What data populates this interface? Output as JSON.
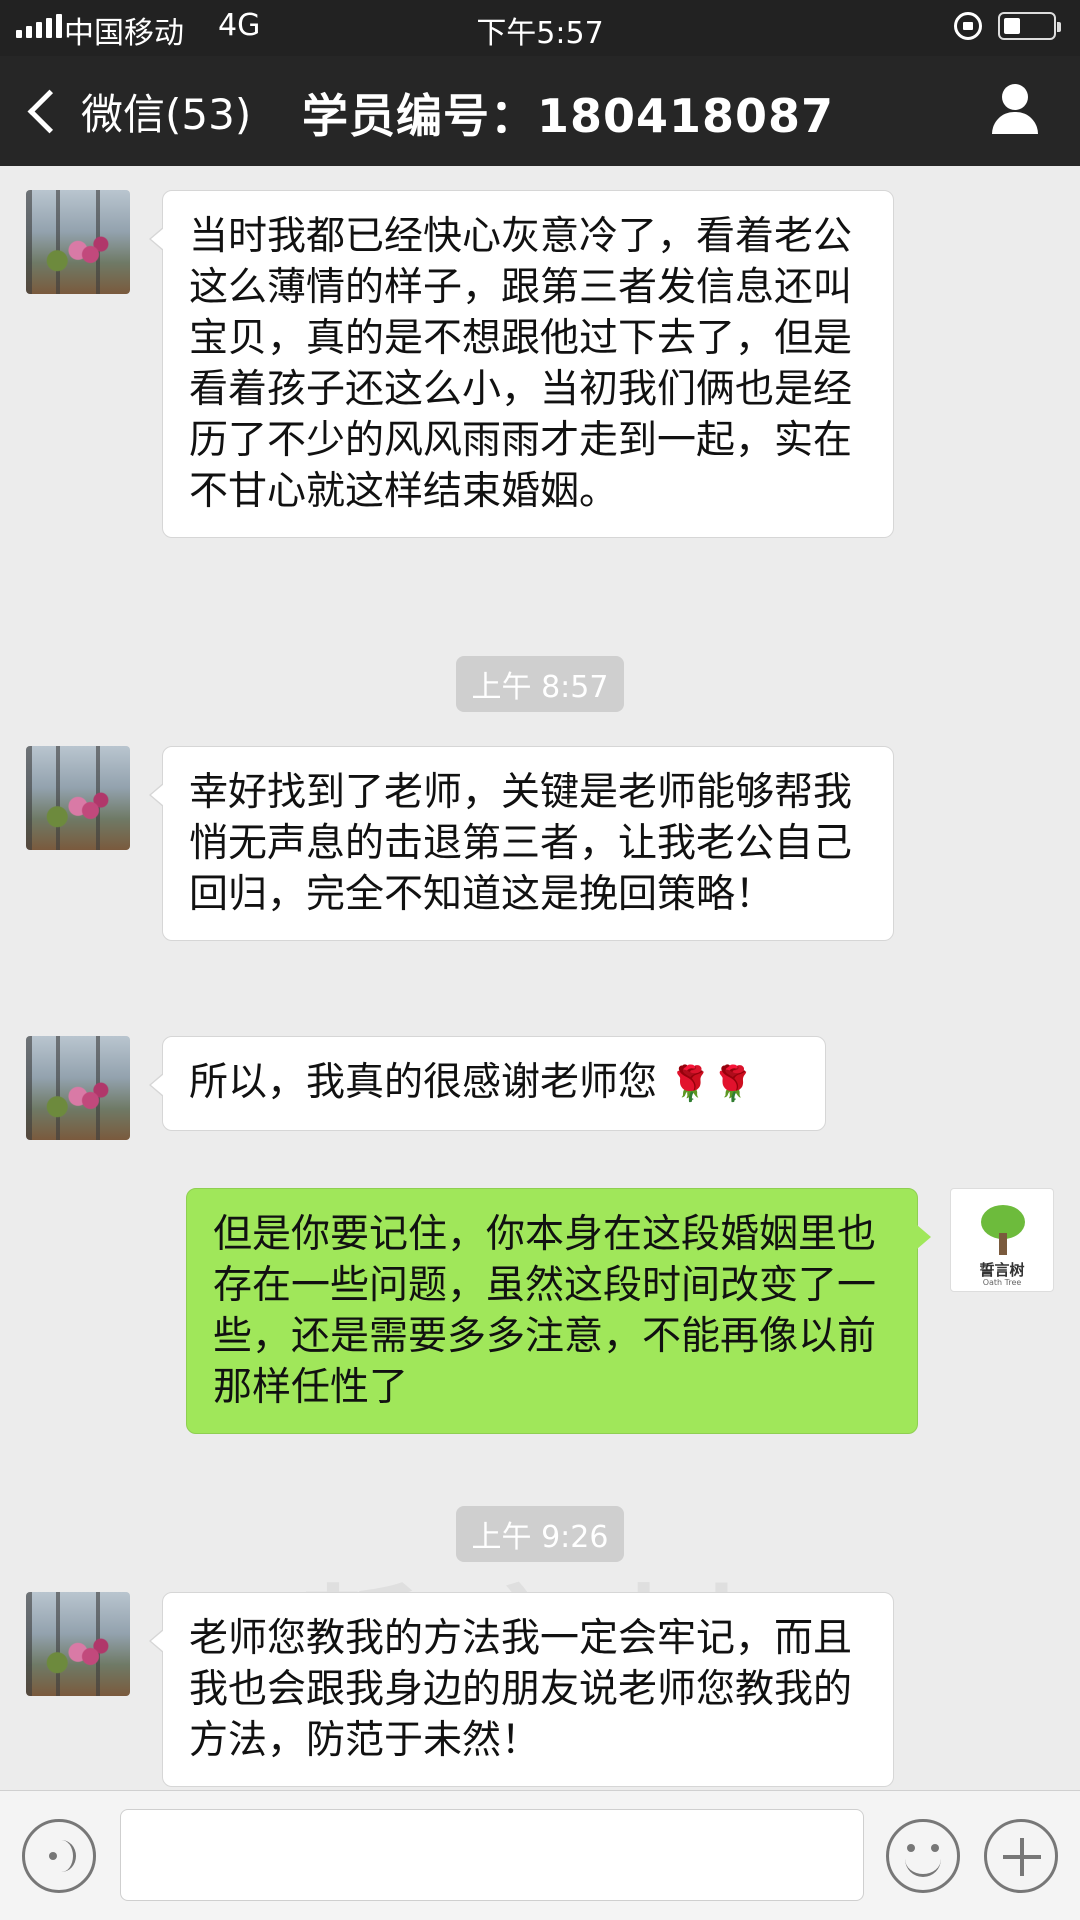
{
  "status_bar": {
    "carrier": "中国移动",
    "network": "4G",
    "time": "下午5:57"
  },
  "header": {
    "back_label": "微信(53)",
    "title": "学员编号：180418087"
  },
  "messages": [
    {
      "side": "left",
      "text": "当时我都已经快心灰意冷了，看着老公这么薄情的样子，跟第三者发信息还叫宝贝，真的是不想跟他过下去了，但是看着孩子还这么小，当初我们俩也是经历了不少的风风雨雨才走到一起，实在不甘心就这样结束婚姻。"
    },
    {
      "timestamp": "上午 8:57"
    },
    {
      "side": "left",
      "text": "幸好找到了老师，关键是老师能够帮我悄无声息的击退第三者，让我老公自己回归，完全不知道这是挽回策略！"
    },
    {
      "side": "left",
      "text": "所以，我真的很感谢老师您",
      "emoji": "🌹🌹"
    },
    {
      "side": "right",
      "text": "但是你要记住，你本身在这段婚姻里也存在一些问题，虽然这段时间改变了一些，还是需要多多注意，不能再像以前那样任性了"
    },
    {
      "timestamp": "上午 9:26"
    },
    {
      "side": "left",
      "text": "老师您教我的方法我一定会牢记，而且我也会跟我身边的朋友说老师您教我的方法，防范于未然！"
    }
  ],
  "brand_avatar": {
    "name": "誓言树",
    "sub": "Oath Tree"
  },
  "watermark": "誓言树",
  "colors": {
    "header_bg": "#262626",
    "chat_bg": "#ececec",
    "outgoing_bubble": "#a0e75a",
    "incoming_bubble": "#ffffff"
  }
}
